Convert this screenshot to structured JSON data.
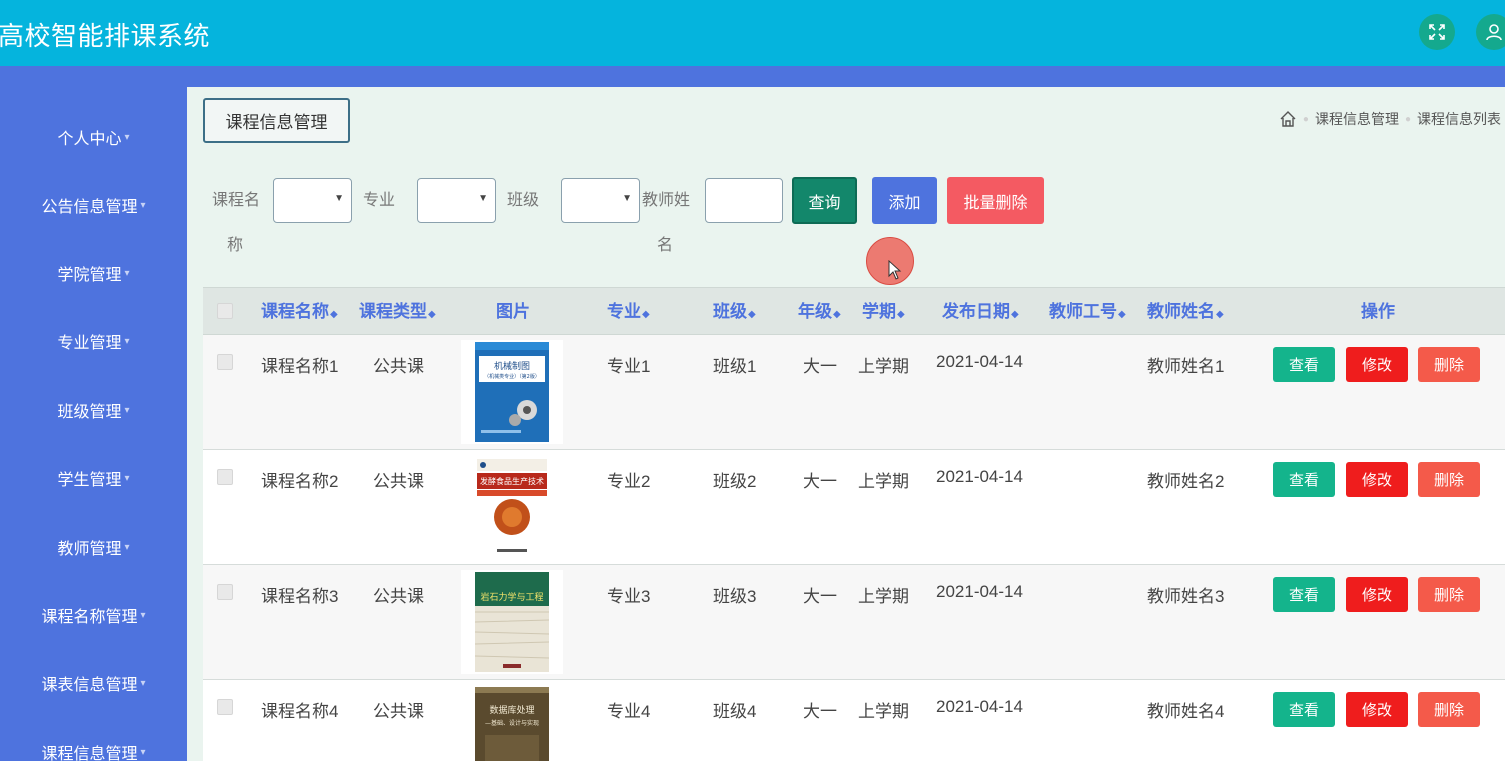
{
  "app": {
    "title": "高校智能排课系统"
  },
  "header": {
    "fullscreen_icon": "fullscreen-icon",
    "user_icon": "user-icon"
  },
  "sidebar": {
    "items": [
      {
        "label": "个人中心"
      },
      {
        "label": "公告信息管理"
      },
      {
        "label": "学院管理"
      },
      {
        "label": "专业管理"
      },
      {
        "label": "班级管理"
      },
      {
        "label": "学生管理"
      },
      {
        "label": "教师管理"
      },
      {
        "label": "课程名称管理"
      },
      {
        "label": "课表信息管理"
      },
      {
        "label": "课程信息管理"
      }
    ]
  },
  "page": {
    "tag": "课程信息管理",
    "breadcrumb": {
      "home_icon": "home-icon",
      "items": [
        "课程信息管理",
        "课程信息列表"
      ]
    }
  },
  "search": {
    "course_name_label_1": "课程名",
    "course_name_label_2": "称",
    "major_label": "专业",
    "class_label": "班级",
    "teacher_label_1": "教师姓",
    "teacher_label_2": "名",
    "course_name_value": "",
    "major_value": "",
    "class_value": "",
    "teacher_value": "",
    "query_button": "查询",
    "add_button": "添加",
    "batch_delete_button": "批量删除"
  },
  "table": {
    "headers": {
      "course_name": "课程名称",
      "course_type": "课程类型",
      "image": "图片",
      "major": "专业",
      "class": "班级",
      "grade": "年级",
      "semester": "学期",
      "publish_date": "发布日期",
      "teacher_id": "教师工号",
      "teacher_name": "教师姓名",
      "actions": "操作"
    },
    "sort_icon": "◆",
    "rows": [
      {
        "course_name": "课程名称1",
        "course_type": "公共课",
        "major": "专业1",
        "class": "班级1",
        "grade": "大一",
        "semester": "上学期",
        "publish_date": "2021-04-14",
        "teacher_id": "",
        "teacher_name": "教师姓名1",
        "cover": {
          "title": "机械制图",
          "subtitle": "（机械类专业）（第2版）",
          "color": "#1f6fb8"
        }
      },
      {
        "course_name": "课程名称2",
        "course_type": "公共课",
        "major": "专业2",
        "class": "班级2",
        "grade": "大一",
        "semester": "上学期",
        "publish_date": "2021-04-14",
        "teacher_id": "",
        "teacher_name": "教师姓名2",
        "cover": {
          "title": "发酵食品生产技术",
          "subtitle": "",
          "color": "#b8291b"
        }
      },
      {
        "course_name": "课程名称3",
        "course_type": "公共课",
        "major": "专业3",
        "class": "班级3",
        "grade": "大一",
        "semester": "上学期",
        "publish_date": "2021-04-14",
        "teacher_id": "",
        "teacher_name": "教师姓名3",
        "cover": {
          "title": "岩石力学与工程",
          "subtitle": "",
          "color": "#1e6b4c"
        }
      },
      {
        "course_name": "课程名称4",
        "course_type": "公共课",
        "major": "专业4",
        "class": "班级4",
        "grade": "大一",
        "semester": "上学期",
        "publish_date": "2021-04-14",
        "teacher_id": "",
        "teacher_name": "教师姓名4",
        "cover": {
          "title": "数据库处理",
          "subtitle": "—基础、设计与实现",
          "color": "#5a4a2e"
        }
      }
    ],
    "actions": {
      "view": "查看",
      "edit": "修改",
      "delete": "删除"
    }
  },
  "colors": {
    "topbar": "#05b4dd",
    "sidebar": "#4e73de",
    "accent_teal": "#14b48c",
    "danger": "#ef1d1d"
  }
}
